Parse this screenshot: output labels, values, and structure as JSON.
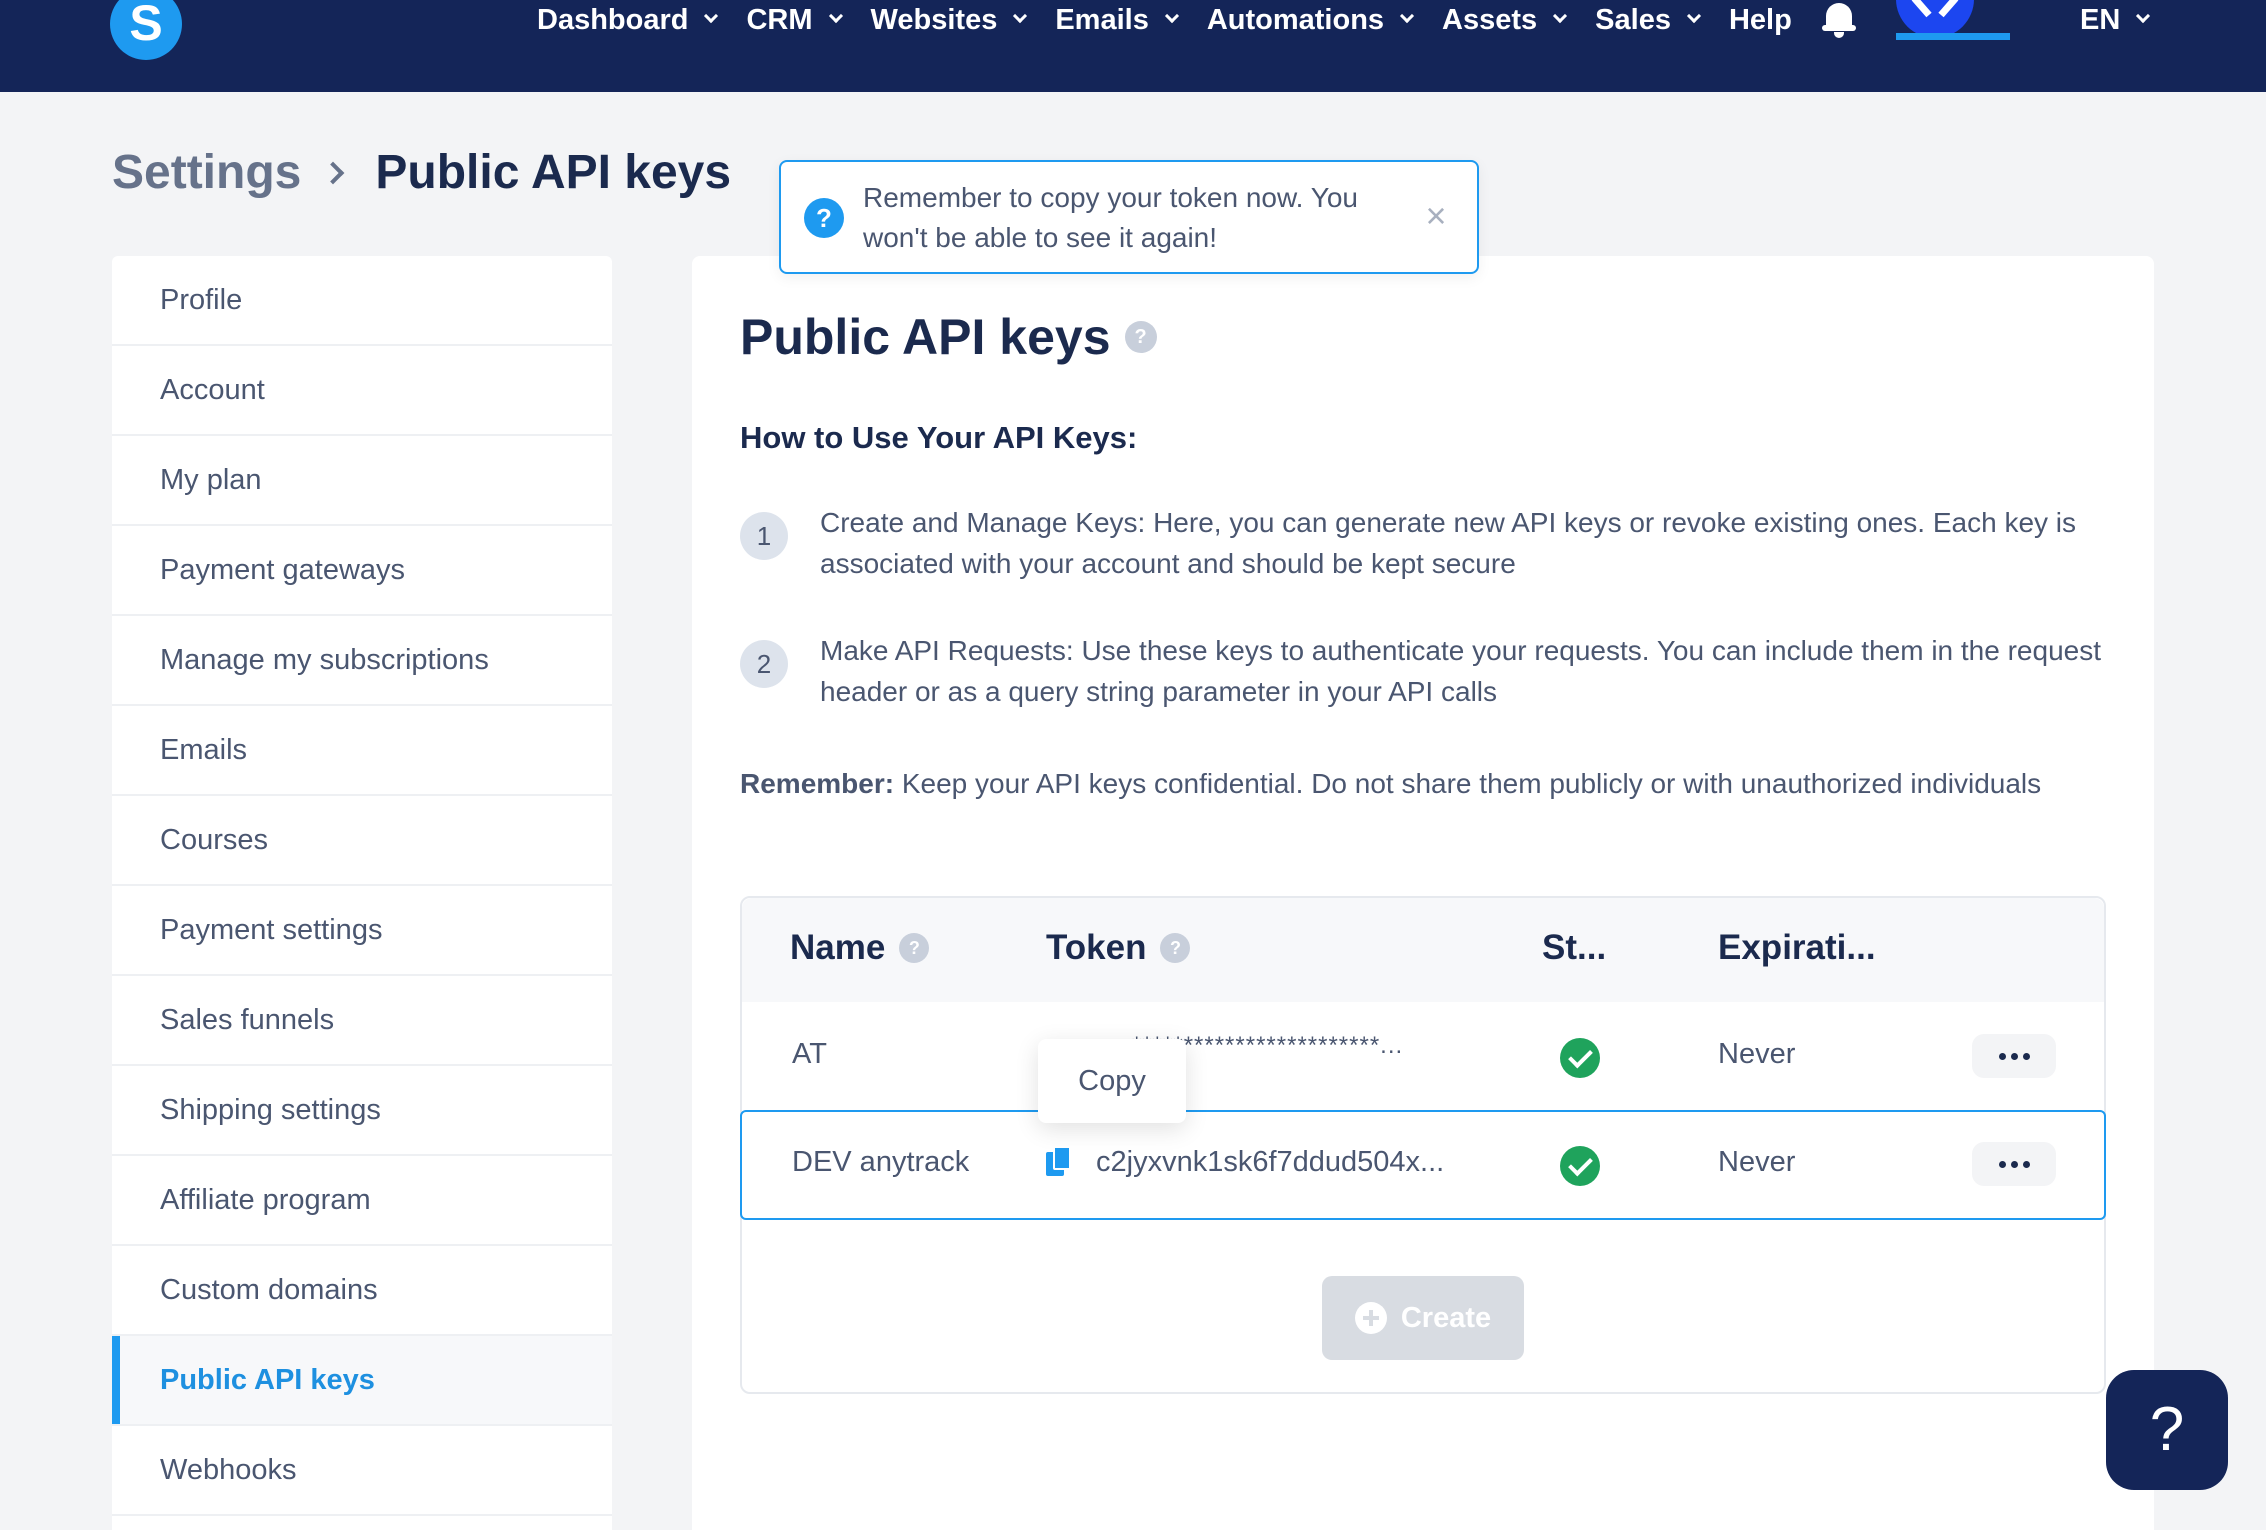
{
  "brand": {
    "logo_letter": "S"
  },
  "nav": {
    "items": [
      {
        "label": "Dashboard",
        "dropdown": true
      },
      {
        "label": "CRM",
        "dropdown": true
      },
      {
        "label": "Websites",
        "dropdown": true
      },
      {
        "label": "Emails",
        "dropdown": true
      },
      {
        "label": "Automations",
        "dropdown": true
      },
      {
        "label": "Assets",
        "dropdown": true
      },
      {
        "label": "Sales",
        "dropdown": true
      },
      {
        "label": "Help",
        "dropdown": false
      }
    ],
    "language": "EN"
  },
  "breadcrumb": {
    "root": "Settings",
    "current": "Public API keys"
  },
  "toast": {
    "text": "Remember to copy your token now. You won't be able to see it again!",
    "icon": "question-icon"
  },
  "sidebar": {
    "items": [
      {
        "label": "Profile",
        "active": false
      },
      {
        "label": "Account",
        "active": false
      },
      {
        "label": "My plan",
        "active": false
      },
      {
        "label": "Payment gateways",
        "active": false
      },
      {
        "label": "Manage my subscriptions",
        "active": false
      },
      {
        "label": "Emails",
        "active": false
      },
      {
        "label": "Courses",
        "active": false
      },
      {
        "label": "Payment settings",
        "active": false
      },
      {
        "label": "Sales funnels",
        "active": false
      },
      {
        "label": "Shipping settings",
        "active": false
      },
      {
        "label": "Affiliate program",
        "active": false
      },
      {
        "label": "Custom domains",
        "active": false
      },
      {
        "label": "Public API keys",
        "active": true
      },
      {
        "label": "Webhooks",
        "active": false
      }
    ]
  },
  "main": {
    "title": "Public API keys",
    "howto_heading": "How to Use Your API Keys:",
    "steps": [
      {
        "num": "1",
        "text": "Create and Manage Keys: Here, you can generate new API keys or revoke existing ones. Each key is associated with your account and should be kept secure"
      },
      {
        "num": "2",
        "text": "Make API Requests: Use these keys to authenticate your requests. You can include them in the request header or as a query string parameter in your API calls"
      }
    ],
    "remember_label": "Remember:",
    "remember_text": " Keep your API keys confidential. Do not share them publicly or with unauthorized individuals"
  },
  "table": {
    "headers": {
      "name": "Name",
      "token": "Token",
      "status": "St...",
      "expiration": "Expirati..."
    },
    "rows": [
      {
        "name": "AT",
        "token": "************************...",
        "status": "active",
        "expiration": "Never"
      },
      {
        "name": "DEV anytrack",
        "token": "c2jyxvnk1sk6f7ddud504x...",
        "status": "active",
        "expiration": "Never"
      }
    ],
    "tooltip": "Copy",
    "create_label": "Create"
  },
  "help_fab": "?",
  "colors": {
    "nav_bg": "#142558",
    "accent": "#1e9af0",
    "success": "#1fa35c"
  }
}
